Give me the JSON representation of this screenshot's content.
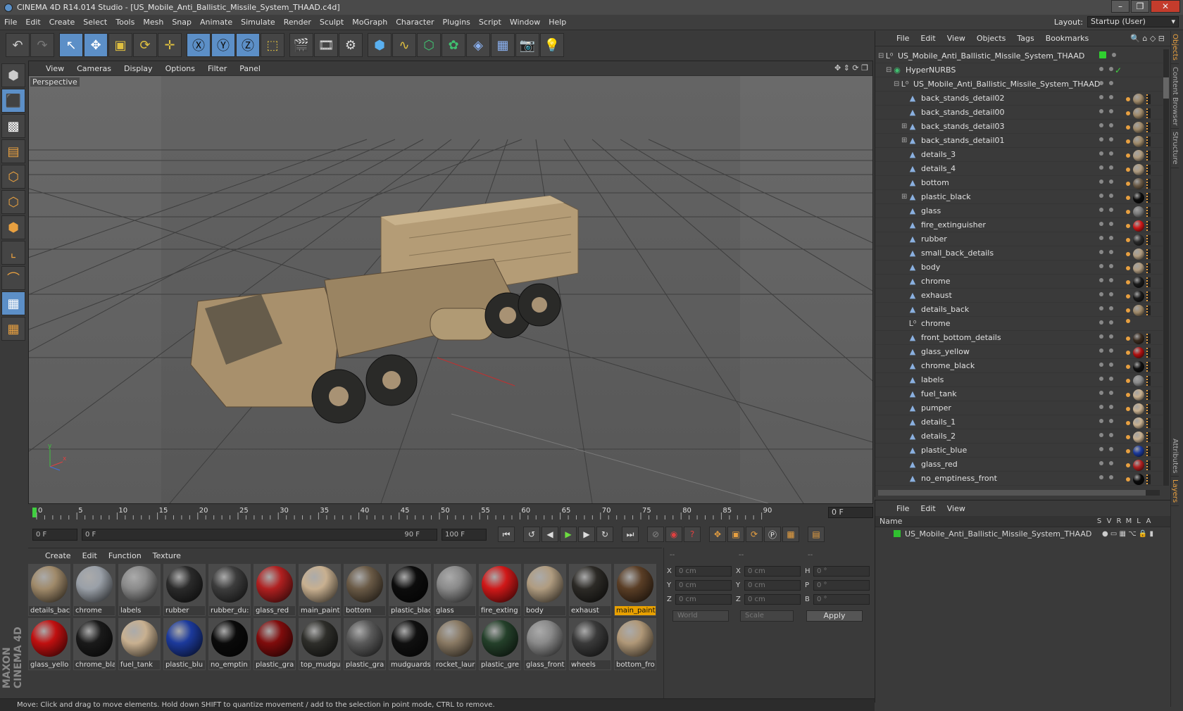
{
  "window": {
    "title": "CINEMA 4D R14.014 Studio - [US_Mobile_Anti_Ballistic_Missile_System_THAAD.c4d]"
  },
  "menubar": [
    "File",
    "Edit",
    "Create",
    "Select",
    "Tools",
    "Mesh",
    "Snap",
    "Animate",
    "Simulate",
    "Render",
    "Sculpt",
    "MoGraph",
    "Character",
    "Plugins",
    "Script",
    "Window",
    "Help"
  ],
  "layout": {
    "label": "Layout:",
    "value": "Startup (User)"
  },
  "viewport": {
    "menu": [
      "View",
      "Cameras",
      "Display",
      "Options",
      "Filter",
      "Panel"
    ],
    "label": "Perspective"
  },
  "timeline": {
    "ticks": [
      "0",
      "5",
      "10",
      "15",
      "20",
      "25",
      "30",
      "35",
      "40",
      "45",
      "50",
      "55",
      "60",
      "65",
      "70",
      "75",
      "80",
      "85",
      "90"
    ],
    "current_frame": "0 F"
  },
  "transport": {
    "start": "0 F",
    "range_start": "0 F",
    "range_end": "90 F",
    "end": "100 F"
  },
  "materials": {
    "menu": [
      "Create",
      "Edit",
      "Function",
      "Texture"
    ],
    "items": [
      {
        "name": "details_bac",
        "color": "#a08a6a"
      },
      {
        "name": "chrome",
        "color": "#9aa0a8"
      },
      {
        "name": "labels",
        "color": "#8a8a8a"
      },
      {
        "name": "rubber",
        "color": "#2a2a2a"
      },
      {
        "name": "rubber_du:",
        "color": "#3c3c3c"
      },
      {
        "name": "glass_red",
        "color": "#b02020"
      },
      {
        "name": "main_paint",
        "color": "#c8b090"
      },
      {
        "name": "bottom",
        "color": "#6a5a46"
      },
      {
        "name": "plastic_blac",
        "color": "#0c0c0c"
      },
      {
        "name": "glass",
        "color": "#8a8a8a"
      },
      {
        "name": "fire_exting",
        "color": "#d01818"
      },
      {
        "name": "body",
        "color": "#b09c80"
      },
      {
        "name": "exhaust",
        "color": "#2c2a26"
      },
      {
        "name": "main_paint",
        "color": "#5a3e26"
      },
      {
        "name": "glass_yello",
        "color": "#c01010"
      },
      {
        "name": "chrome_bla",
        "color": "#1a1a1a"
      },
      {
        "name": "fuel_tank",
        "color": "#c8b090"
      },
      {
        "name": "plastic_blu",
        "color": "#1c3a9c"
      },
      {
        "name": "no_emptin",
        "color": "#0a0a0a"
      },
      {
        "name": "plastic_gra",
        "color": "#800c0c"
      },
      {
        "name": "top_mudgu",
        "color": "#2e2e2a"
      },
      {
        "name": "plastic_gra",
        "color": "#5a5a5a"
      },
      {
        "name": "mudguards",
        "color": "#101010"
      },
      {
        "name": "rocket_laur",
        "color": "#8a7a64"
      },
      {
        "name": "plastic_gre",
        "color": "#24402a"
      },
      {
        "name": "glass_front",
        "color": "#8a8a8a"
      },
      {
        "name": "wheels",
        "color": "#3a3a3a"
      },
      {
        "name": "bottom_fro",
        "color": "#b09878"
      }
    ],
    "active_index": 13
  },
  "coords": {
    "header": [
      "--",
      "--",
      "--"
    ],
    "rows": [
      {
        "l1": "X",
        "v1": "0 cm",
        "l2": "X",
        "v2": "0 cm",
        "l3": "H",
        "v3": "0 °"
      },
      {
        "l1": "Y",
        "v1": "0 cm",
        "l2": "Y",
        "v2": "0 cm",
        "l3": "P",
        "v3": "0 °"
      },
      {
        "l1": "Z",
        "v1": "0 cm",
        "l2": "Z",
        "v2": "0 cm",
        "l3": "B",
        "v3": "0 °"
      }
    ],
    "space": "World",
    "mode": "Scale",
    "apply": "Apply"
  },
  "objects": {
    "menu": [
      "File",
      "Edit",
      "View",
      "Objects",
      "Tags",
      "Bookmarks"
    ],
    "tree": [
      {
        "name": "US_Mobile_Anti_Ballistic_Missile_System_THAAD",
        "depth": 0,
        "icon": "null-icon",
        "tag": "none"
      },
      {
        "name": "HyperNURBS",
        "depth": 1,
        "icon": "hypernurbs-icon",
        "tag": "check"
      },
      {
        "name": "US_Mobile_Anti_Ballistic_Missile_System_THAAD",
        "depth": 2,
        "icon": "null-icon",
        "tag": "none"
      },
      {
        "name": "back_stands_detail02",
        "depth": 3,
        "icon": "polygon-icon",
        "ball": "#a08a6a"
      },
      {
        "name": "back_stands_detail00",
        "depth": 3,
        "icon": "polygon-icon",
        "ball": "#a08a6a"
      },
      {
        "name": "back_stands_detail03",
        "depth": 3,
        "icon": "polygon-icon",
        "ball": "#a08a6a"
      },
      {
        "name": "back_stands_detail01",
        "depth": 3,
        "icon": "polygon-icon",
        "ball": "#a08a6a"
      },
      {
        "name": "details_3",
        "depth": 3,
        "icon": "polygon-icon",
        "ball": "#b09c80"
      },
      {
        "name": "details_4",
        "depth": 3,
        "icon": "polygon-icon",
        "ball": "#b09c80"
      },
      {
        "name": "bottom",
        "depth": 3,
        "icon": "polygon-icon",
        "ball": "#6a5a46"
      },
      {
        "name": "plastic_black",
        "depth": 3,
        "icon": "polygon-icon",
        "ball": "#0c0c0c"
      },
      {
        "name": "glass",
        "depth": 3,
        "icon": "polygon-icon",
        "ball": "#7a7a7a"
      },
      {
        "name": "fire_extinguisher",
        "depth": 3,
        "icon": "polygon-icon",
        "ball": "#d01818"
      },
      {
        "name": "rubber",
        "depth": 3,
        "icon": "polygon-icon",
        "ball": "#2a2a2a"
      },
      {
        "name": "small_back_details",
        "depth": 3,
        "icon": "polygon-icon",
        "ball": "#b09c80"
      },
      {
        "name": "body",
        "depth": 3,
        "icon": "polygon-icon",
        "ball": "#b09c80"
      },
      {
        "name": "chrome",
        "depth": 3,
        "icon": "polygon-icon",
        "ball": "#1a1a1a"
      },
      {
        "name": "exhaust",
        "depth": 3,
        "icon": "polygon-icon",
        "ball": "#1a1a1a"
      },
      {
        "name": "details_back",
        "depth": 3,
        "icon": "polygon-icon",
        "ball": "#a08a6a"
      },
      {
        "name": "chrome",
        "depth": 3,
        "icon": "null-icon",
        "ball": ""
      },
      {
        "name": "front_bottom_details",
        "depth": 3,
        "icon": "polygon-icon",
        "ball": "#3a2c20"
      },
      {
        "name": "glass_yellow",
        "depth": 3,
        "icon": "polygon-icon",
        "ball": "#b01010"
      },
      {
        "name": "chrome_black",
        "depth": 3,
        "icon": "polygon-icon",
        "ball": "#101010"
      },
      {
        "name": "labels",
        "depth": 3,
        "icon": "polygon-icon",
        "ball": "#8a8a8a"
      },
      {
        "name": "fuel_tank",
        "depth": 3,
        "icon": "polygon-icon",
        "ball": "#c8b090"
      },
      {
        "name": "pumper",
        "depth": 3,
        "icon": "polygon-icon",
        "ball": "#c8b090"
      },
      {
        "name": "details_1",
        "depth": 3,
        "icon": "polygon-icon",
        "ball": "#c8b090"
      },
      {
        "name": "details_2",
        "depth": 3,
        "icon": "polygon-icon",
        "ball": "#c8b090"
      },
      {
        "name": "plastic_blue",
        "depth": 3,
        "icon": "polygon-icon",
        "ball": "#1c3a9c"
      },
      {
        "name": "glass_red",
        "depth": 3,
        "icon": "polygon-icon",
        "ball": "#b02020"
      },
      {
        "name": "no_emptiness_front",
        "depth": 3,
        "icon": "polygon-icon",
        "ball": "#0a0a0a"
      }
    ]
  },
  "layers": {
    "menu": [
      "File",
      "Edit",
      "View"
    ],
    "header_name": "Name",
    "columns": [
      "S",
      "V",
      "R",
      "M",
      "L",
      "A"
    ],
    "rows": [
      {
        "name": "US_Mobile_Anti_Ballistic_Missile_System_THAAD",
        "color": "#30c030"
      }
    ]
  },
  "side_tabs": [
    "Objects",
    "Content Browser",
    "Structure"
  ],
  "side_tabs_lower": [
    "Attributes",
    "Layers"
  ],
  "status": "Move: Click and drag to move elements. Hold down SHIFT to quantize movement / add to the selection in point mode, CTRL to remove."
}
